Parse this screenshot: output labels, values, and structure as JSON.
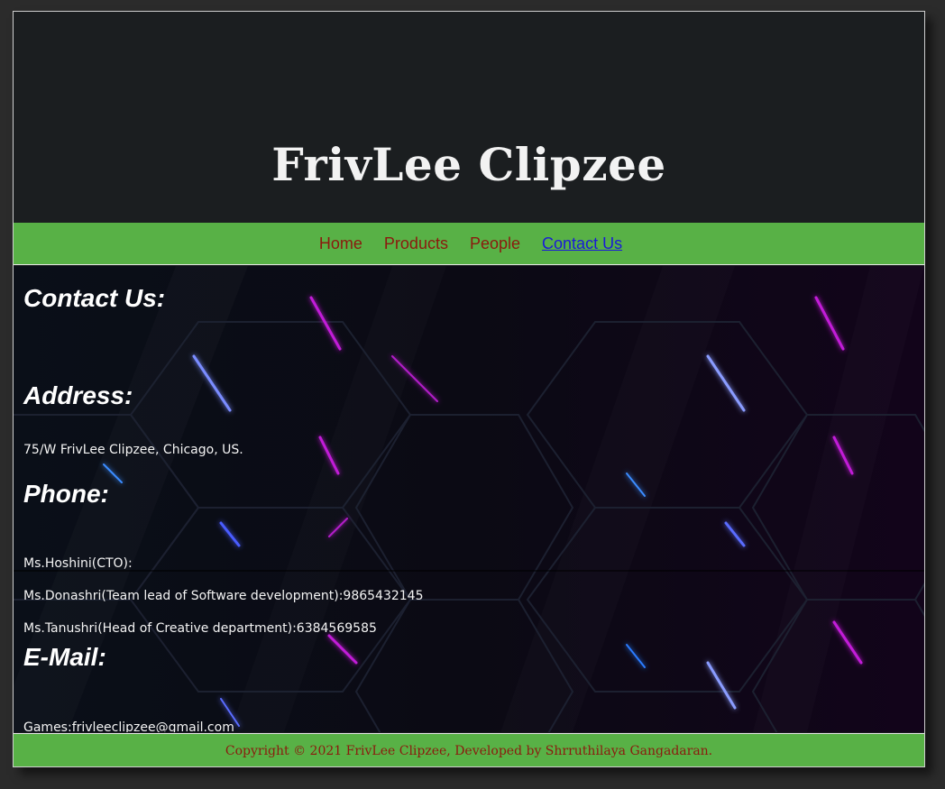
{
  "header": {
    "title": "FrivLee Clipzee"
  },
  "nav": {
    "items": [
      {
        "label": "Home"
      },
      {
        "label": "Products"
      },
      {
        "label": "People"
      },
      {
        "label": "Contact Us"
      }
    ],
    "active": "Contact Us"
  },
  "contact": {
    "heading": "Contact Us:",
    "address_heading": "Address:",
    "address": "75/W FrivLee Clipzee, Chicago, US.",
    "phone_heading": "Phone:",
    "phones": [
      "Ms.Hoshini(CTO):",
      "Ms.Donashri(Team lead of Software development):9865432145",
      "Ms.Tanushri(Head of Creative department):6384569585"
    ],
    "email_heading": "E-Mail:",
    "email": "Games:frivleeclipzee@gmail.com"
  },
  "footer": {
    "text": "Copyright © 2021 FrivLee Clipzee, Developed by Shrruthilaya Gangadaran."
  },
  "colors": {
    "header_bg": "#1b1e20",
    "nav_bg": "#58b146",
    "nav_link": "#8b1a0e",
    "nav_active": "#1a1ad8",
    "glow_purple": "#c21ed8",
    "glow_blue": "#3a5cff"
  }
}
